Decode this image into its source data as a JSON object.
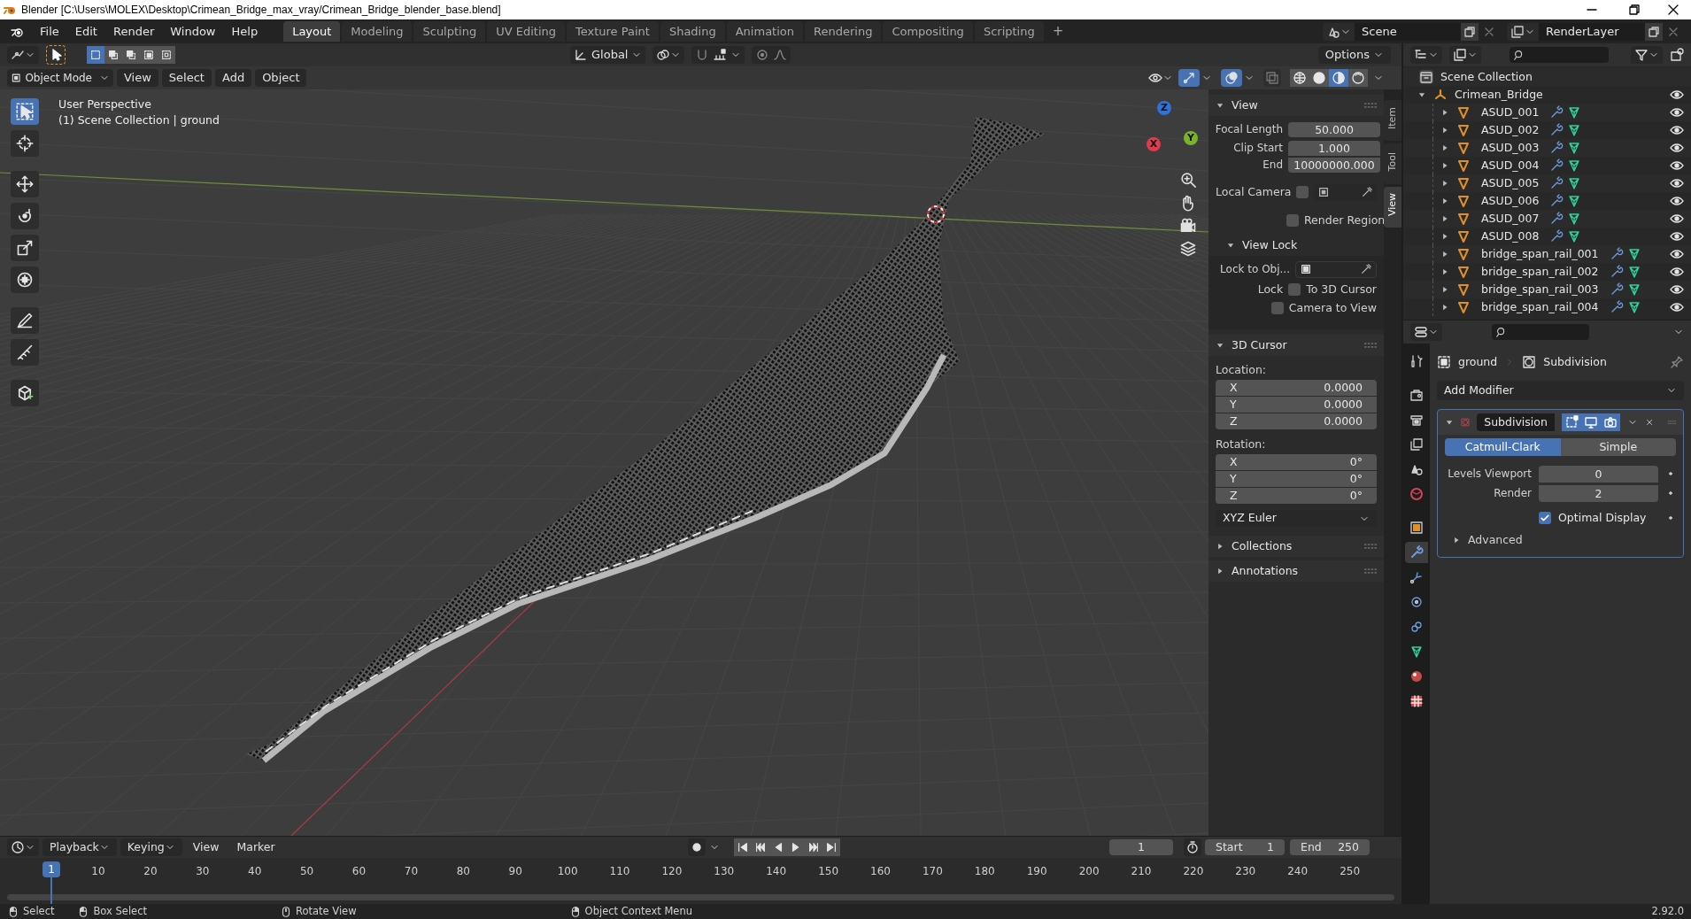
{
  "window": {
    "title": "Blender [C:\\Users\\MOLEX\\Desktop\\Crimean_Bridge_max_vray/Crimean_Bridge_blender_base.blend]"
  },
  "menu": [
    "File",
    "Edit",
    "Render",
    "Window",
    "Help"
  ],
  "workspaces": [
    {
      "label": "Layout",
      "selected": true
    },
    {
      "label": "Modeling",
      "selected": false
    },
    {
      "label": "Sculpting",
      "selected": false
    },
    {
      "label": "UV Editing",
      "selected": false
    },
    {
      "label": "Texture Paint",
      "selected": false
    },
    {
      "label": "Shading",
      "selected": false
    },
    {
      "label": "Animation",
      "selected": false
    },
    {
      "label": "Rendering",
      "selected": false
    },
    {
      "label": "Compositing",
      "selected": false
    },
    {
      "label": "Scripting",
      "selected": false
    }
  ],
  "add_workspace": "+",
  "scene": "Scene",
  "view_layer": "RenderLayer",
  "tool_header": {
    "select_modes": [
      {
        "kind": "set",
        "selected": true
      },
      {
        "kind": "extend",
        "selected": false
      },
      {
        "kind": "subtract",
        "selected": false
      },
      {
        "kind": "invert",
        "selected": false
      },
      {
        "kind": "intersect",
        "selected": false
      }
    ],
    "orientation": "Global",
    "options": "Options"
  },
  "view_header": {
    "mode": "Object Mode",
    "menus": [
      "View",
      "Select",
      "Add",
      "Object"
    ],
    "gizmos_on": true,
    "overlays_on": true,
    "shading_modes": [
      {
        "kind": "wireframe",
        "selected": false
      },
      {
        "kind": "solid",
        "selected": false
      },
      {
        "kind": "material",
        "selected": true
      },
      {
        "kind": "rendered",
        "selected": false
      }
    ]
  },
  "viewport": {
    "info": [
      "User Perspective",
      "(1) Scene Collection | ground"
    ],
    "tools": [
      {
        "kind": "select_box",
        "selected": true
      },
      {
        "kind": "cursor",
        "selected": false
      },
      {
        "kind": "move",
        "selected": false
      },
      {
        "kind": "rotate",
        "selected": false
      },
      {
        "kind": "scale",
        "selected": false
      },
      {
        "kind": "transform",
        "selected": false
      },
      {
        "kind": "annotate",
        "selected": false
      },
      {
        "kind": "measure",
        "selected": false
      },
      {
        "kind": "add_cube",
        "selected": false
      }
    ],
    "gizmo_axes": [
      {
        "label": "Z",
        "color": "#2f72d8"
      },
      {
        "label": "Y",
        "color": "#7ab32a"
      },
      {
        "label": "X",
        "color": "#e03a4e"
      }
    ]
  },
  "sidebar": {
    "tabs": [
      {
        "label": "Item",
        "selected": false
      },
      {
        "label": "Tool",
        "selected": false
      },
      {
        "label": "View",
        "selected": true
      }
    ],
    "view": {
      "title": "View",
      "expanded": true,
      "focal_length": {
        "label": "Focal Length",
        "value": "50.000"
      },
      "clip_start": {
        "label": "Clip Start",
        "value": "1.000"
      },
      "clip_end": {
        "label": "End",
        "value": "10000000.000"
      },
      "local_camera": {
        "label": "Local Camera",
        "checked": false
      },
      "render_region": {
        "label": "Render Region",
        "checked": false
      },
      "view_lock": {
        "title": "View Lock",
        "expanded": true,
        "lock_to_object": "Lock to Obj...",
        "lock": "Lock",
        "options": [
          {
            "label": "To 3D Cursor",
            "checked": false
          },
          {
            "label": "Camera to View",
            "checked": false
          }
        ]
      }
    },
    "cursor": {
      "title": "3D Cursor",
      "expanded": true,
      "location_label": "Location:",
      "location": [
        {
          "axis": "X",
          "value": "0.0000"
        },
        {
          "axis": "Y",
          "value": "0.0000"
        },
        {
          "axis": "Z",
          "value": "0.0000"
        }
      ],
      "rotation_label": "Rotation:",
      "rotation": [
        {
          "axis": "X",
          "value": "0°"
        },
        {
          "axis": "Y",
          "value": "0°"
        },
        {
          "axis": "Z",
          "value": "0°"
        }
      ],
      "rotation_mode": "XYZ Euler"
    },
    "collapsed": [
      {
        "title": "Collections",
        "expanded": false
      },
      {
        "title": "Annotations",
        "expanded": false
      }
    ]
  },
  "outliner": {
    "root": "Scene Collection",
    "collection": {
      "label": "Crimean_Bridge",
      "expanded": true,
      "children": [
        {
          "label": "ASUD_001",
          "expanded": false
        },
        {
          "label": "ASUD_002",
          "expanded": false
        },
        {
          "label": "ASUD_003",
          "expanded": false
        },
        {
          "label": "ASUD_004",
          "expanded": false
        },
        {
          "label": "ASUD_005",
          "expanded": false
        },
        {
          "label": "ASUD_006",
          "expanded": false
        },
        {
          "label": "ASUD_007",
          "expanded": false
        },
        {
          "label": "ASUD_008",
          "expanded": false
        },
        {
          "label": "bridge_span_rail_001",
          "expanded": false
        },
        {
          "label": "bridge_span_rail_002",
          "expanded": false
        },
        {
          "label": "bridge_span_rail_003",
          "expanded": false
        },
        {
          "label": "bridge_span_rail_004",
          "expanded": false
        }
      ]
    }
  },
  "properties": {
    "tabs": [
      {
        "kind": "tool",
        "selected": false
      },
      {
        "kind": "render",
        "selected": false
      },
      {
        "kind": "output",
        "selected": false
      },
      {
        "kind": "view_layer",
        "selected": false
      },
      {
        "kind": "scene",
        "selected": false
      },
      {
        "kind": "world",
        "selected": false
      },
      {
        "kind": "object",
        "selected": false
      },
      {
        "kind": "modifier",
        "selected": true
      },
      {
        "kind": "particles",
        "selected": false
      },
      {
        "kind": "physics",
        "selected": false
      },
      {
        "kind": "constraints",
        "selected": false
      },
      {
        "kind": "data",
        "selected": false
      },
      {
        "kind": "material",
        "selected": false
      },
      {
        "kind": "texture",
        "selected": false
      }
    ],
    "breadcrumb": [
      "ground",
      "Subdivision"
    ],
    "add_modifier": "Add Modifier",
    "modifier": {
      "name": "Subdivision",
      "expanded": true,
      "edit_mode": true,
      "viewport": true,
      "render": true,
      "types": [
        {
          "label": "Catmull-Clark",
          "selected": true
        },
        {
          "label": "Simple",
          "selected": false
        }
      ],
      "levels_viewport": {
        "label": "Levels Viewport",
        "value": "0"
      },
      "render_levels": {
        "label": "Render",
        "value": "2"
      },
      "optimal_display": {
        "label": "Optimal Display",
        "checked": true
      },
      "advanced": {
        "label": "Advanced",
        "expanded": false
      }
    }
  },
  "timeline": {
    "menus": [
      "Playback",
      "Keying",
      "View",
      "Marker"
    ],
    "current_frame": "1",
    "start_label": "Start",
    "start": "1",
    "end_label": "End",
    "end": "250",
    "playhead": "1",
    "ticks": [
      "10",
      "20",
      "30",
      "40",
      "50",
      "60",
      "70",
      "80",
      "90",
      "100",
      "110",
      "120",
      "130",
      "140",
      "150",
      "160",
      "170",
      "180",
      "190",
      "200",
      "210",
      "220",
      "230",
      "240",
      "250"
    ]
  },
  "status_bar": {
    "items": [
      {
        "kind": "left",
        "label": "Select"
      },
      {
        "kind": "left",
        "label": "Box Select"
      },
      {
        "kind": "middle",
        "label": "Rotate View"
      },
      {
        "kind": "right",
        "label": "Object Context Menu"
      }
    ],
    "version": "2.92.0"
  }
}
